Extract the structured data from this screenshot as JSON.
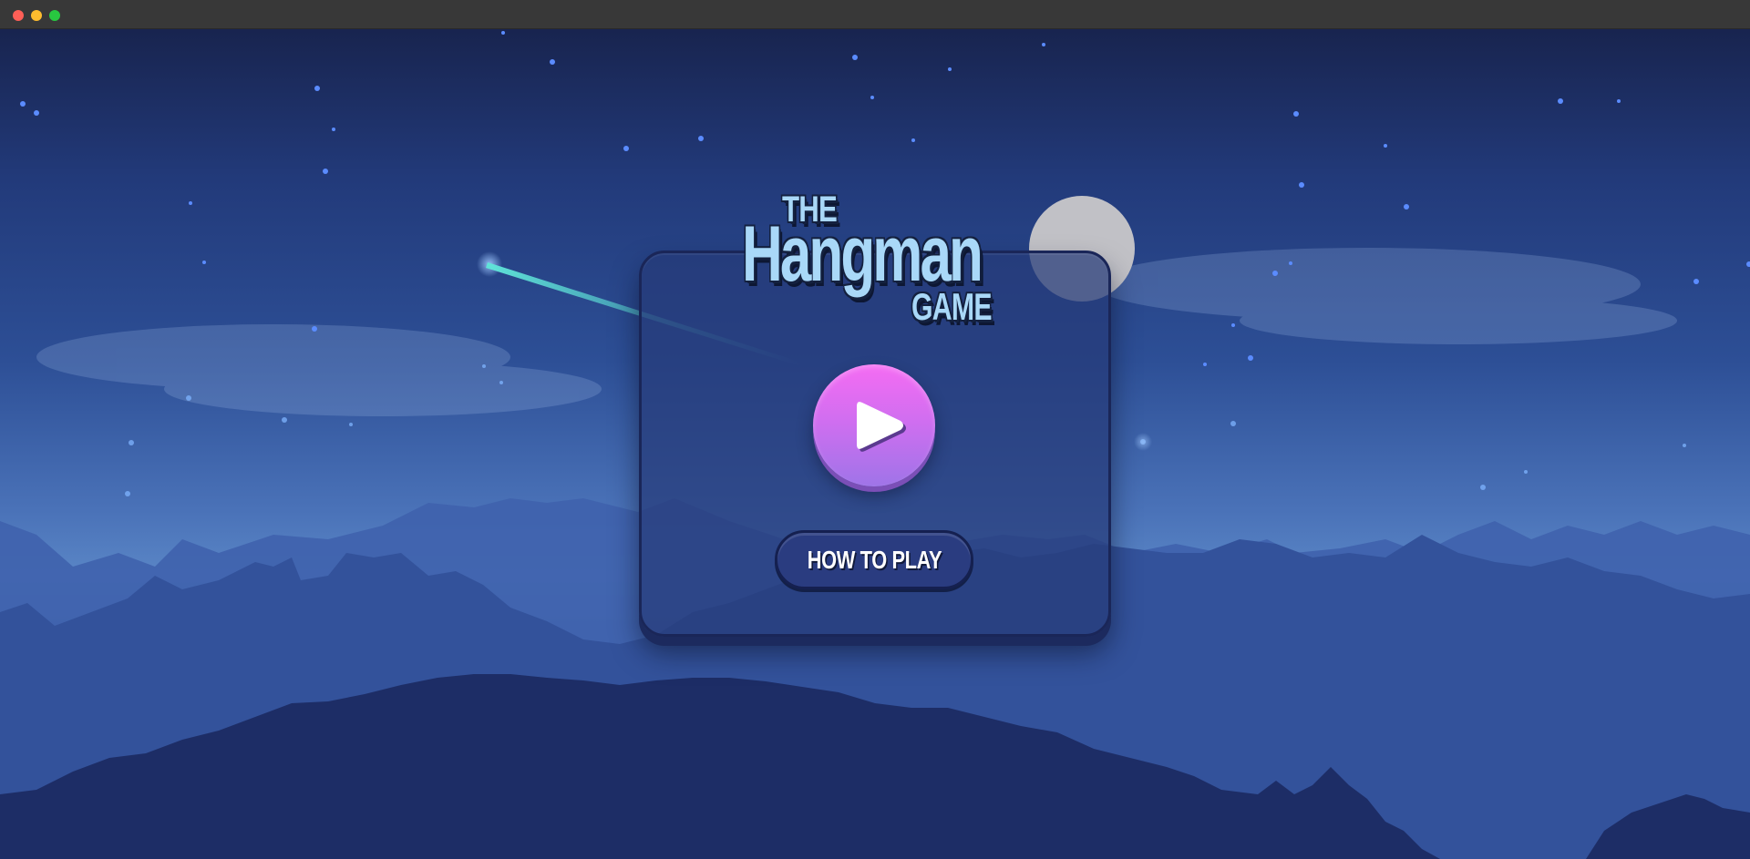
{
  "window": {
    "controls": [
      "close",
      "minimize",
      "maximize"
    ]
  },
  "game": {
    "logo": {
      "line1": "THE",
      "line2": "Hangman",
      "line3": "GAME"
    },
    "play_button_icon": "play-icon",
    "how_to_play_label": "HOW TO PLAY"
  },
  "colors": {
    "sky_top": "#18244f",
    "sky_glow": "#5a86c6",
    "panel": "#263a78",
    "play_gradient_top": "#f56cf3",
    "play_gradient_bottom": "#9f74e8",
    "logo_text": "#a9d8f8",
    "moon": "#c1c1c6",
    "shooting_star": "#4fd6d0"
  }
}
